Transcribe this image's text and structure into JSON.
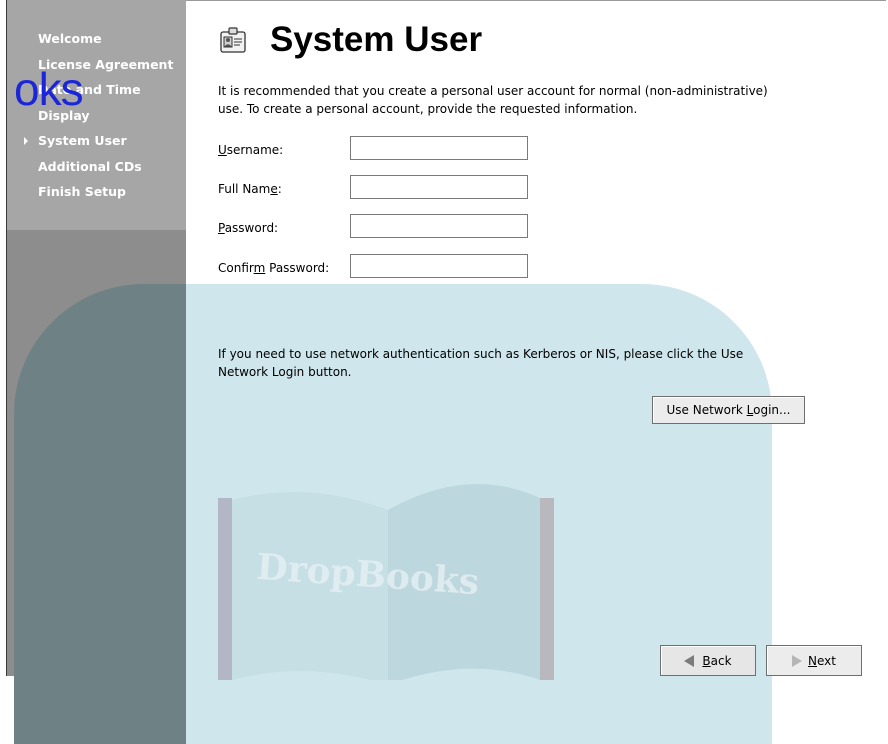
{
  "colors": {
    "sidebar_bg": "#8d8d8d",
    "sidebar_text": "#ffffff",
    "watermark_text": "#1b25d9",
    "background_shape": "#cfe6ec"
  },
  "watermark": {
    "text": "oks",
    "book_text": "DropBooks"
  },
  "sidebar": {
    "items": [
      {
        "label": "Welcome",
        "current": false
      },
      {
        "label": "License Agreement",
        "current": false
      },
      {
        "label": "Date and Time",
        "current": false
      },
      {
        "label": "Display",
        "current": false
      },
      {
        "label": "System User",
        "current": true
      },
      {
        "label": "Additional CDs",
        "current": false
      },
      {
        "label": "Finish Setup",
        "current": false
      }
    ]
  },
  "header": {
    "icon": "id-card-icon",
    "title": "System User"
  },
  "intro": {
    "text": "It is recommended that you create a personal user account for normal (non-administrative) use.  To create a personal account, provide the requested information."
  },
  "form": {
    "username": {
      "label_pre": "",
      "label_mnemonic": "U",
      "label_post": "sername:",
      "value": ""
    },
    "fullname": {
      "label_pre": "Full Nam",
      "label_mnemonic": "e",
      "label_post": ":",
      "value": ""
    },
    "password": {
      "label_pre": "",
      "label_mnemonic": "P",
      "label_post": "assword:",
      "value": ""
    },
    "confirm": {
      "label_pre": "Confir",
      "label_mnemonic": "m",
      "label_post": " Password:",
      "value": ""
    }
  },
  "network": {
    "text": "If you need to use network authentication such as Kerberos or NIS, please click the Use Network Login button.",
    "button_pre": "Use Network ",
    "button_mnemonic": "L",
    "button_post": "ogin..."
  },
  "footer": {
    "back": {
      "icon": "back-arrow-icon",
      "mnemonic": "B",
      "rest": "ack"
    },
    "next": {
      "icon": "next-arrow-icon",
      "mnemonic": "N",
      "rest": "ext"
    }
  }
}
